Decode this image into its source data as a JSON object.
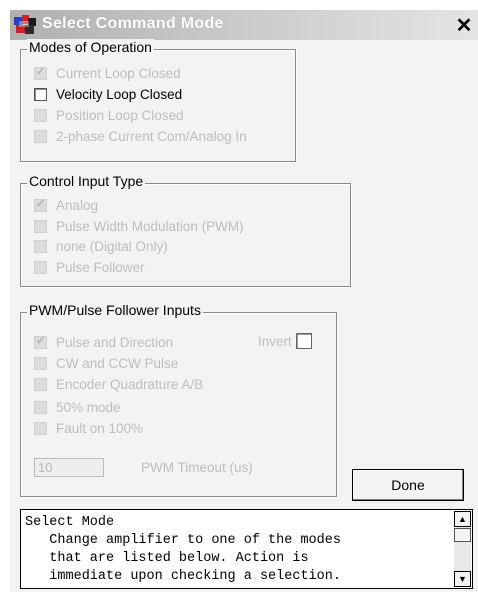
{
  "window": {
    "title": "Select Command Mode",
    "close_glyph": "✕"
  },
  "modes": {
    "label": "Modes of Operation",
    "options": [
      {
        "label": "Current Loop Closed",
        "checked": true,
        "enabled": false
      },
      {
        "label": "Velocity Loop Closed",
        "checked": false,
        "enabled": true
      },
      {
        "label": "Position Loop Closed",
        "checked": false,
        "enabled": false
      },
      {
        "label": "2-phase Current Com/Analog In",
        "checked": false,
        "enabled": false
      }
    ]
  },
  "control": {
    "label": "Control Input Type",
    "options": [
      {
        "label": "Analog",
        "checked": true,
        "enabled": false
      },
      {
        "label": "Pulse Width Modulation (PWM)",
        "checked": false,
        "enabled": false
      },
      {
        "label": "none (Digital Only)",
        "checked": false,
        "enabled": false
      },
      {
        "label": "Pulse Follower",
        "checked": false,
        "enabled": false
      }
    ]
  },
  "pwm": {
    "label": "PWM/Pulse Follower Inputs",
    "invert_label": "Invert",
    "options": [
      {
        "label": "Pulse and Direction",
        "checked": true,
        "enabled": false
      },
      {
        "label": "CW and CCW Pulse",
        "checked": false,
        "enabled": false
      },
      {
        "label": "Encoder Quadrature A/B",
        "checked": false,
        "enabled": false
      },
      {
        "label": "50% mode",
        "checked": false,
        "enabled": false
      },
      {
        "label": "Fault on 100%",
        "checked": false,
        "enabled": false
      }
    ],
    "timeout_value": "10",
    "timeout_label": "PWM Timeout (us)"
  },
  "done_label": "Done",
  "help": {
    "text": "Select Mode\n   Change amplifier to one of the modes\n   that are listed below. Action is\n   immediate upon checking a selection."
  },
  "scroll": {
    "up_glyph": "▲",
    "down_glyph": "▼"
  },
  "icons": {
    "app": "app-icon",
    "close": "close-icon"
  }
}
